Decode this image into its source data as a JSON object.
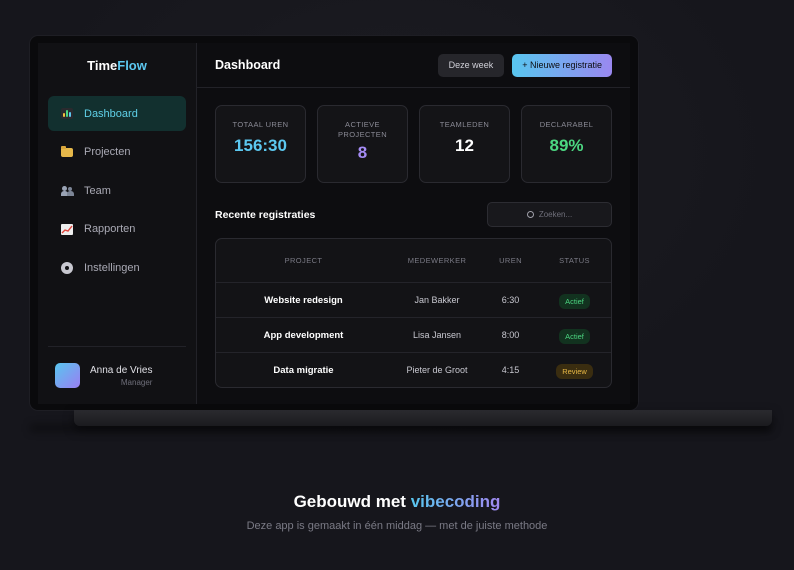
{
  "app": {
    "logo_part1": "Time",
    "logo_part2": "Flow"
  },
  "sidebar": {
    "items": [
      {
        "label": "Dashboard",
        "icon": "chart-icon",
        "active": true
      },
      {
        "label": "Projecten",
        "icon": "folder-icon"
      },
      {
        "label": "Team",
        "icon": "team-icon"
      },
      {
        "label": "Rapporten",
        "icon": "graph-icon"
      },
      {
        "label": "Instellingen",
        "icon": "gear-icon"
      }
    ],
    "user": {
      "name": "Anna de Vries",
      "role": "Manager"
    }
  },
  "header": {
    "title": "Dashboard",
    "week_button": "Deze week",
    "new_button": "+ Nieuwe registratie"
  },
  "stats": [
    {
      "label": "Totaal uren",
      "value": "156:30",
      "color": "#5cc8f0"
    },
    {
      "label": "Actieve projecten",
      "value": "8",
      "color": "#a58cf5"
    },
    {
      "label": "Teamleden",
      "value": "12",
      "color": "#ffffff"
    },
    {
      "label": "Declarabel",
      "value": "89%",
      "color": "#4cd681"
    }
  ],
  "recent": {
    "title": "Recente registraties",
    "search_placeholder": "Zoeken...",
    "columns": [
      "Project",
      "Medewerker",
      "Uren",
      "Status"
    ],
    "rows": [
      {
        "project": "Website redesign",
        "employee": "Jan Bakker",
        "hours": "6:30",
        "status": "Actief"
      },
      {
        "project": "App development",
        "employee": "Lisa Jansen",
        "hours": "8:00",
        "status": "Actief"
      },
      {
        "project": "Data migratie",
        "employee": "Pieter de Groot",
        "hours": "4:15",
        "status": "Review"
      }
    ]
  },
  "footer": {
    "headline_prefix": "Gebouwd met ",
    "headline_accent": "vibecoding",
    "subline": "Deze app is gemaakt in één middag — met de juiste methode"
  },
  "colors": {
    "accent": "#5cc8f0",
    "accent2": "#9a88f0",
    "success": "#4cd681",
    "warning": "#e8b845"
  }
}
